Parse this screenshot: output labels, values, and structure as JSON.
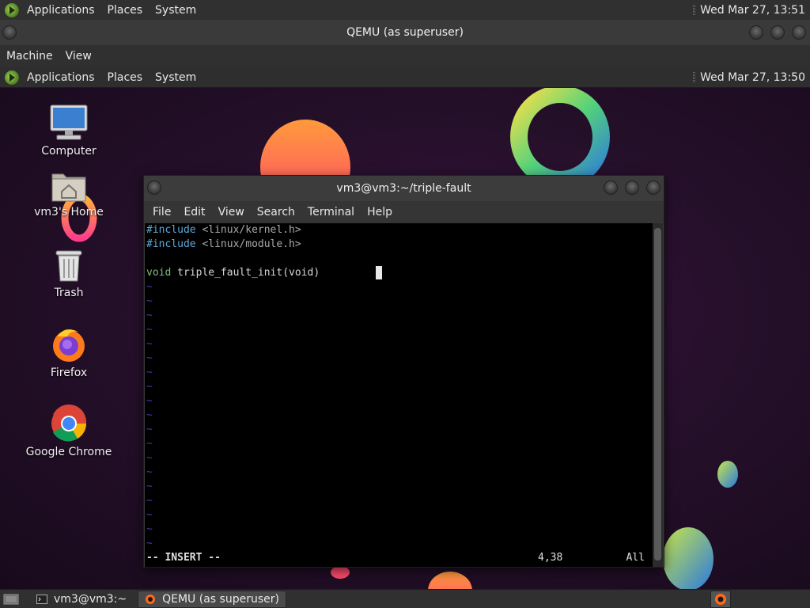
{
  "host_panel": {
    "menus": [
      "Applications",
      "Places",
      "System"
    ],
    "clock": "Wed Mar 27, 13:51"
  },
  "host_window": {
    "title": "QEMU (as superuser)",
    "menus": [
      "Machine",
      "View"
    ]
  },
  "guest_panel": {
    "menus": [
      "Applications",
      "Places",
      "System"
    ],
    "clock": "Wed Mar 27, 13:50"
  },
  "desktop_icons": [
    {
      "label": "Computer",
      "icon": "computer-icon"
    },
    {
      "label": "vm3's Home",
      "icon": "home-folder-icon"
    },
    {
      "label": "Trash",
      "icon": "trash-icon"
    },
    {
      "label": "Firefox",
      "icon": "firefox-icon"
    },
    {
      "label": "Google Chrome",
      "icon": "chrome-icon"
    }
  ],
  "terminal": {
    "title": "vm3@vm3:~/triple-fault",
    "menus": [
      "File",
      "Edit",
      "View",
      "Search",
      "Terminal",
      "Help"
    ],
    "lines": [
      {
        "kw": "#include",
        "rest": " <linux/kernel.h>"
      },
      {
        "kw": "#include",
        "rest": " <linux/module.h>"
      },
      {
        "kw": "",
        "rest": ""
      },
      {
        "ty": "void",
        "rest": " triple_fault_init(void)"
      }
    ],
    "tilde_char": "~",
    "tilde_count": 19,
    "status": {
      "mode": "-- INSERT --",
      "position": "4,38",
      "scroll": "All"
    }
  },
  "taskbar": {
    "tasks": [
      {
        "label": "vm3@vm3:~",
        "active": false
      },
      {
        "label": "QEMU (as superuser)",
        "active": true
      }
    ]
  }
}
